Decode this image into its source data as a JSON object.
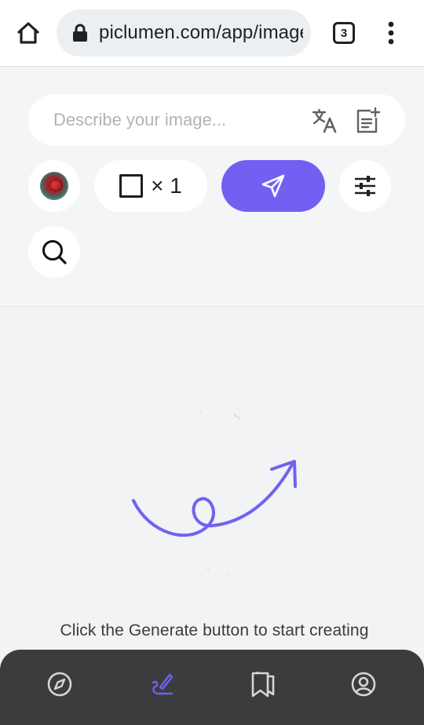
{
  "browser": {
    "url": "piclumen.com/app/image-generator",
    "tab_count": "3",
    "home_icon": "home-icon",
    "lock_icon": "lock-icon",
    "menu_icon": "more-vert-icon"
  },
  "prompt": {
    "placeholder": "Describe your image...",
    "value": "",
    "translate_icon": "translate-icon",
    "notes_icon": "note-add-icon"
  },
  "controls": {
    "model_avatar": "rose-avatar",
    "image_count": "× 1",
    "generate_icon": "send-icon",
    "settings_icon": "tune-icon",
    "search_icon": "search-icon",
    "accent_color": "#7360f2"
  },
  "empty_state": {
    "hint": "Click the Generate button to start creating"
  },
  "nav": {
    "items": [
      {
        "name": "explore",
        "icon": "compass-icon",
        "active": false
      },
      {
        "name": "create",
        "icon": "create-icon",
        "active": true
      },
      {
        "name": "collection",
        "icon": "collection-icon",
        "active": false
      },
      {
        "name": "profile",
        "icon": "account-icon",
        "active": false
      }
    ],
    "active_color": "#7360f2",
    "inactive_color": "#d6d6d6",
    "background": "#3a3c3d"
  }
}
